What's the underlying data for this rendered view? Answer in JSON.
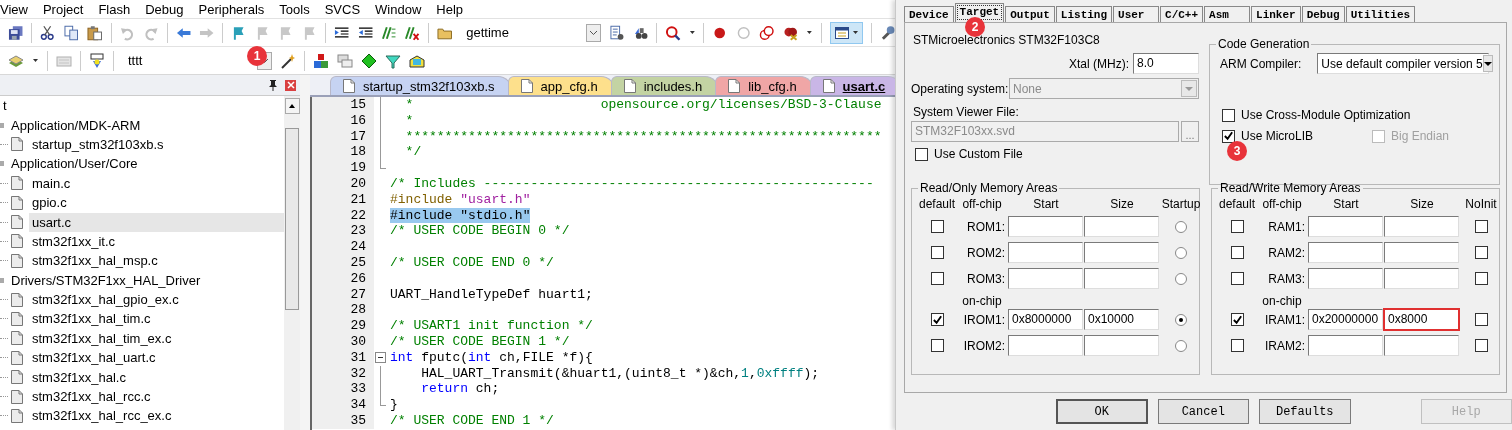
{
  "menu": [
    "View",
    "Project",
    "Flash",
    "Debug",
    "Peripherals",
    "Tools",
    "SVCS",
    "Window",
    "Help"
  ],
  "toolbar": {
    "find_text": "gettime",
    "target": "tttt",
    "badge": "1"
  },
  "project_panel": {
    "tree": [
      {
        "label": "t",
        "selected": false,
        "children": [
          {
            "label": "Application/MDK-ARM",
            "selected": false,
            "children": [
              {
                "label": "startup_stm32f103xb.s",
                "selected": false
              }
            ]
          },
          {
            "label": "Application/User/Core",
            "selected": false,
            "children": [
              {
                "label": "main.c",
                "selected": false
              },
              {
                "label": "gpio.c",
                "selected": false
              },
              {
                "label": "usart.c",
                "selected": true
              },
              {
                "label": "stm32f1xx_it.c",
                "selected": false
              },
              {
                "label": "stm32f1xx_hal_msp.c",
                "selected": false
              }
            ]
          },
          {
            "label": "Drivers/STM32F1xx_HAL_Driver",
            "selected": false,
            "children": [
              {
                "label": "stm32f1xx_hal_gpio_ex.c",
                "selected": false
              },
              {
                "label": "stm32f1xx_hal_tim.c",
                "selected": false
              },
              {
                "label": "stm32f1xx_hal_tim_ex.c",
                "selected": false
              },
              {
                "label": "stm32f1xx_hal_uart.c",
                "selected": false
              },
              {
                "label": "stm32f1xx_hal.c",
                "selected": false
              },
              {
                "label": "stm32f1xx_hal_rcc.c",
                "selected": false
              },
              {
                "label": "stm32f1xx_hal_rcc_ex.c",
                "selected": false
              }
            ]
          }
        ]
      }
    ]
  },
  "editor": {
    "tabs": [
      {
        "label": "startup_stm32f103xb.s",
        "color": "#c6d3f2",
        "selected": false
      },
      {
        "label": "app_cfg.h",
        "color": "#fde08c",
        "selected": false
      },
      {
        "label": "includes.h",
        "color": "#c3d3a3",
        "selected": false
      },
      {
        "label": "lib_cfg.h",
        "color": "#f0a6a6",
        "selected": false
      },
      {
        "label": "usart.c",
        "color": "#c9b6e6",
        "selected": true
      }
    ],
    "lines": [
      {
        "number": "15",
        "selected": false,
        "kind": "fold-line",
        "segments": [
          {
            "kind": "comment",
            "text": "  *                        opensource.org/licenses/BSD-3-Clause"
          }
        ]
      },
      {
        "number": "16",
        "selected": false,
        "kind": "fold-line",
        "segments": [
          {
            "kind": "comment",
            "text": "  *"
          }
        ]
      },
      {
        "number": "17",
        "selected": false,
        "kind": "fold-line",
        "segments": [
          {
            "kind": "comment",
            "text": "  *************************************************************"
          }
        ]
      },
      {
        "number": "18",
        "selected": false,
        "kind": "fold-line",
        "segments": [
          {
            "kind": "comment",
            "text": "  */"
          }
        ]
      },
      {
        "number": "19",
        "selected": false,
        "kind": "fold-end"
      },
      {
        "number": "20",
        "selected": false,
        "kind": "plain",
        "segments": [
          {
            "kind": "comment",
            "text": "/* Includes --------------------------------------------------"
          }
        ]
      },
      {
        "number": "21",
        "selected": false,
        "kind": "plain",
        "segments": [
          {
            "kind": "directive",
            "text": "#include "
          },
          {
            "kind": "string",
            "text": "\"usart.h\""
          }
        ]
      },
      {
        "number": "22",
        "selected": true,
        "kind": "plain",
        "segments": [
          {
            "kind": "directive",
            "text": "#include "
          },
          {
            "kind": "string",
            "text": "\"stdio.h\""
          }
        ]
      },
      {
        "number": "23",
        "selected": false,
        "kind": "plain",
        "segments": [
          {
            "kind": "comment",
            "text": "/* USER CODE BEGIN 0 */"
          }
        ]
      },
      {
        "number": "24",
        "selected": false,
        "kind": "plain"
      },
      {
        "number": "25",
        "selected": false,
        "kind": "plain",
        "segments": [
          {
            "kind": "comment",
            "text": "/* USER CODE END 0 */"
          }
        ]
      },
      {
        "number": "26",
        "selected": false,
        "kind": "plain"
      },
      {
        "number": "27",
        "selected": false,
        "kind": "plain",
        "segments": [
          {
            "kind": "plain",
            "text": "UART_HandleTypeDef huart1;"
          }
        ]
      },
      {
        "number": "28",
        "selected": false,
        "kind": "plain"
      },
      {
        "number": "29",
        "selected": false,
        "kind": "plain",
        "segments": [
          {
            "kind": "comment",
            "text": "/* USART1 init function */"
          }
        ]
      },
      {
        "number": "30",
        "selected": false,
        "kind": "plain",
        "segments": [
          {
            "kind": "comment",
            "text": "/* USER CODE BEGIN 1 */"
          }
        ]
      },
      {
        "number": "31",
        "selected": false,
        "kind": "fold-start",
        "segments": [
          {
            "kind": "keyword",
            "text": "int"
          },
          {
            "kind": "plain",
            "text": " fputc("
          },
          {
            "kind": "keyword",
            "text": "int"
          },
          {
            "kind": "plain",
            "text": " ch,FILE *f){"
          }
        ]
      },
      {
        "number": "32",
        "selected": false,
        "kind": "fold-line",
        "segments": [
          {
            "kind": "plain",
            "text": "    HAL_UART_Transmit(&huart1,(uint8_t *)&ch,"
          },
          {
            "kind": "number",
            "text": "1"
          },
          {
            "kind": "plain",
            "text": ","
          },
          {
            "kind": "number",
            "text": "0xffff"
          },
          {
            "kind": "plain",
            "text": ");"
          }
        ]
      },
      {
        "number": "33",
        "selected": false,
        "kind": "fold-line",
        "segments": [
          {
            "kind": "keyword",
            "text": "    return"
          },
          {
            "kind": "plain",
            "text": " ch;"
          }
        ]
      },
      {
        "number": "34",
        "selected": false,
        "kind": "fold-end",
        "segments": [
          {
            "kind": "plain",
            "text": "}"
          }
        ]
      },
      {
        "number": "35",
        "selected": false,
        "kind": "plain",
        "segments": [
          {
            "kind": "comment",
            "text": "/* USER CODE END 1 */"
          }
        ]
      }
    ]
  },
  "options_dialog": {
    "tabs": [
      {
        "label": "Device",
        "selected": false
      },
      {
        "label": "Target",
        "selected": true,
        "badge": "2"
      },
      {
        "label": "Output",
        "selected": false
      },
      {
        "label": "Listing",
        "selected": false
      },
      {
        "label": "User",
        "selected": false
      },
      {
        "label": "C/C++",
        "selected": false
      },
      {
        "label": "Asm",
        "selected": false
      },
      {
        "label": "Linker",
        "selected": false
      },
      {
        "label": "Debug",
        "selected": false
      },
      {
        "label": "Utilities",
        "selected": false
      }
    ],
    "device": "STMicroelectronics STM32F103C8",
    "xtal": {
      "label": "Xtal (MHz):",
      "value": "8.0"
    },
    "operating_system": {
      "label": "Operating system:",
      "value": "None",
      "disabled": true
    },
    "system_viewer_file": {
      "label": "System Viewer File:",
      "value": "STM32F103xx.svd",
      "disabled": true,
      "browse": "..."
    },
    "use_custom_file": {
      "label": "Use Custom File",
      "checked": false
    },
    "code_generation": {
      "title": "Code Generation",
      "compiler_label": "ARM Compiler:",
      "compiler": "Use default compiler version 5",
      "options": [
        {
          "label": "Use Cross-Module Optimization",
          "checked": false,
          "disabled": false
        },
        {
          "label": "Use MicroLIB",
          "checked": true,
          "disabled": false,
          "badge": "3"
        },
        {
          "label": "Big Endian",
          "checked": false,
          "disabled": true
        }
      ]
    },
    "read_only_memory": {
      "title": "Read/Only Memory Areas",
      "columns": [
        "default",
        "off-chip",
        "Start",
        "Size",
        "Startup"
      ],
      "on_chip_label": "on-chip",
      "rows": [
        {
          "kind": "off-chip",
          "name": "ROM1:",
          "default": false,
          "last": false,
          "highlighted": false
        },
        {
          "kind": "off-chip",
          "name": "ROM2:",
          "default": false,
          "last": false,
          "highlighted": false
        },
        {
          "kind": "off-chip",
          "name": "ROM3:",
          "default": false,
          "last": false,
          "highlighted": false
        },
        {
          "kind": "on-chip",
          "name": "IROM1:",
          "default": true,
          "start": "0x8000000",
          "size": "0x10000",
          "last": true,
          "highlighted": false
        },
        {
          "kind": "on-chip",
          "name": "IROM2:",
          "default": false,
          "last": false,
          "highlighted": false
        }
      ]
    },
    "read_write_memory": {
      "title": "Read/Write Memory Areas",
      "columns": [
        "default",
        "off-chip",
        "Start",
        "Size",
        "NoInit"
      ],
      "on_chip_label": "on-chip",
      "rows": [
        {
          "kind": "off-chip",
          "name": "RAM1:",
          "default": false,
          "last": false,
          "highlighted": false
        },
        {
          "kind": "off-chip",
          "name": "RAM2:",
          "default": false,
          "last": false,
          "highlighted": false
        },
        {
          "kind": "off-chip",
          "name": "RAM3:",
          "default": false,
          "last": false,
          "highlighted": false
        },
        {
          "kind": "on-chip",
          "name": "IRAM1:",
          "default": true,
          "start": "0x20000000",
          "size": "0x8000",
          "last": false,
          "highlighted": true
        },
        {
          "kind": "on-chip",
          "name": "IRAM2:",
          "default": false,
          "last": false,
          "highlighted": false
        }
      ]
    },
    "buttons": [
      {
        "label": "OK",
        "disabled": false
      },
      {
        "label": "Cancel",
        "disabled": false
      },
      {
        "label": "Defaults",
        "disabled": false
      },
      {
        "label": "Help",
        "disabled": true
      }
    ]
  }
}
